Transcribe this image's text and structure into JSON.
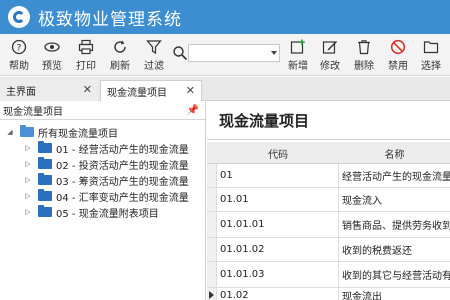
{
  "app": {
    "title": "极致物业管理系统"
  },
  "toolbar": {
    "help": "帮助",
    "preview": "预览",
    "print": "打印",
    "refresh": "刷新",
    "filter": "过滤",
    "add": "新增",
    "edit": "修改",
    "delete": "删除",
    "disable": "禁用",
    "select": "选择",
    "search_value": ""
  },
  "tabs": {
    "home": "主界面",
    "cashflow": "现金流量项目"
  },
  "tree": {
    "header": "现金流量项目",
    "root": "所有现金流量项目",
    "items": [
      {
        "code": "01",
        "label": "01 - 经营活动产生的现金流量"
      },
      {
        "code": "02",
        "label": "02 - 投资活动产生的现金流量"
      },
      {
        "code": "03",
        "label": "03 - 筹资活动产生的现金流量"
      },
      {
        "code": "04",
        "label": "04 - 汇率变动产生的现金流量"
      },
      {
        "code": "05",
        "label": "05 - 现金流量附表项目"
      }
    ]
  },
  "content": {
    "title": "现金流量项目",
    "columns": [
      "代码",
      "名称"
    ],
    "rows": [
      {
        "code": "01",
        "name": "经营活动产生的现金流量"
      },
      {
        "code": "01.01",
        "name": "现金流入"
      },
      {
        "code": "01.01.01",
        "name": "销售商品、提供劳务收到的现金"
      },
      {
        "code": "01.01.02",
        "name": "收到的税费返还"
      },
      {
        "code": "01.01.03",
        "name": "收到的其它与经营活动有关的现金"
      },
      {
        "code": "01.02",
        "name": "现金流出"
      }
    ]
  },
  "colors": {
    "titlebar": "#3c8ed0",
    "folder": "#2d6fbf"
  }
}
